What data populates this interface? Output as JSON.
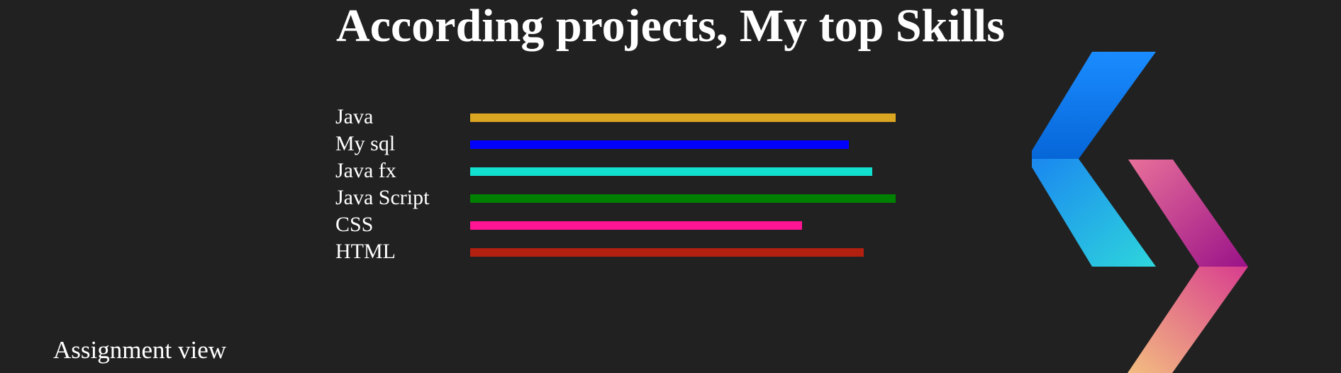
{
  "page": {
    "title": "According projects, My top Skills"
  },
  "skills": [
    {
      "name": "Java",
      "level": 1.0,
      "color": "#DAA520"
    },
    {
      "name": "My sql",
      "level": 0.89,
      "color": "#0000FF"
    },
    {
      "name": "Java fx",
      "level": 0.945,
      "color": "#12E0CF"
    },
    {
      "name": "Java Script",
      "level": 1.0,
      "color": "#008000"
    },
    {
      "name": "CSS",
      "level": 0.78,
      "color": "#FF1493"
    },
    {
      "name": "HTML",
      "level": 0.925,
      "color": "#B22010"
    }
  ],
  "footer": {
    "link_label": "Assignment view"
  },
  "logo": {
    "icon": "chevron-brackets-logo",
    "colors": {
      "left_top": "#0A7CFF",
      "left_bottom": "#28D0E0",
      "right_top": "#E0508A",
      "right_mid": "#A8188A",
      "right_bottom": "#F2B07A"
    }
  }
}
